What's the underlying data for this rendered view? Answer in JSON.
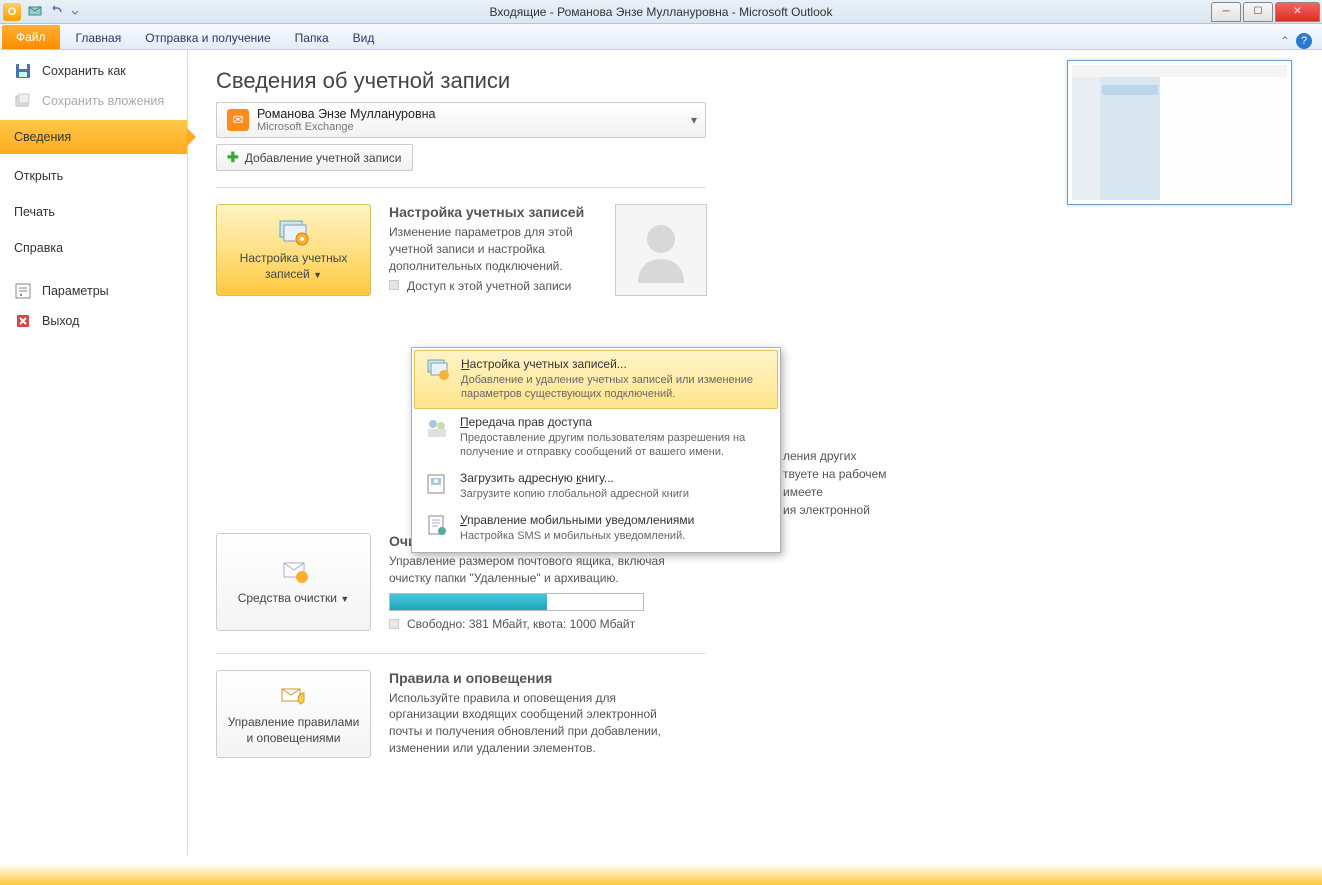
{
  "titlebar": {
    "title": "Входящие - Романова Энзе Муллануровна  -  Microsoft Outlook"
  },
  "tabs": {
    "file": "Файл",
    "home": "Главная",
    "sendreceive": "Отправка и получение",
    "folder": "Папка",
    "view": "Вид"
  },
  "sidebar": {
    "save_as": "Сохранить как",
    "save_attachments": "Сохранить вложения",
    "info": "Сведения",
    "open": "Открыть",
    "print": "Печать",
    "help": "Справка",
    "options": "Параметры",
    "exit": "Выход"
  },
  "page": {
    "title": "Сведения об учетной записи",
    "account_name": "Романова Энзе Муллануровна",
    "account_type": "Microsoft Exchange",
    "add_account": "Добавление учетной записи"
  },
  "section1": {
    "btn": "Настройка учетных записей",
    "title": "Настройка учетных записей",
    "desc": "Изменение параметров для этой учетной записи и настройка дополнительных подключений.",
    "bullet": "Доступ к этой учетной записи"
  },
  "menu": {
    "i1_title": "Настройка учетных записей...",
    "i1_desc": "Добавление и удаление учетных записей или изменение параметров существующих подключений.",
    "i2_title": "Передача прав доступа",
    "i2_desc": "Предоставление другим пользователям разрешения на получение и отправку сообщений от вашего имени.",
    "i3_title": "Загрузить адресную книгу...",
    "i3_desc": "Загрузите копию глобальной адресной книги",
    "i4_title": "Управление мобильными уведомлениями",
    "i4_desc": "Настройка SMS и мобильных уведомлений."
  },
  "hidden_text": {
    "l1": "ления других",
    "l2": "твуете на рабочем",
    "l3": "имеете",
    "l4": "ия электронной"
  },
  "section2": {
    "btn": "Средства очистки",
    "title": "Очистка почтового ящика",
    "desc": "Управление размером почтового ящика, включая очистку папки \"Удаленные\" и архивацию.",
    "quota": "Свободно: 381 Мбайт, квота: 1000 Мбайт",
    "fill_pct": 62
  },
  "section3": {
    "btn": "Управление правилами и оповещениями",
    "title": "Правила и оповещения",
    "desc": "Используйте правила и оповещения для организации входящих сообщений электронной почты и получения обновлений при добавлении, изменении или удалении элементов."
  }
}
